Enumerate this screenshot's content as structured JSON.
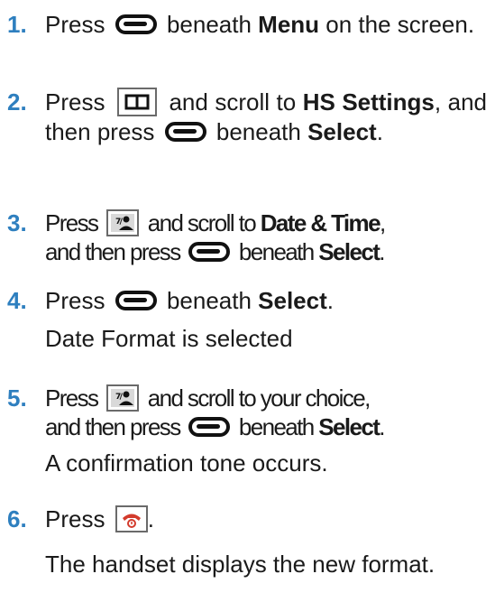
{
  "steps": [
    {
      "num": "1.",
      "t1": "Press",
      "t2": "beneath",
      "t3": "Menu",
      "t4": "on the screen."
    },
    {
      "num": "2.",
      "t1": "Press",
      "t2": "and scroll to",
      "t3": "HS Settings",
      "t4": ", and then press",
      "t5": "beneath",
      "t6": "Select",
      "t7": "."
    },
    {
      "num": "3.",
      "t1": "Press",
      "t2": "and scroll to",
      "t3": "Date & Time",
      "t4": ",",
      "t5": "and then press",
      "t6": "beneath",
      "t7": "Select",
      "t8": "."
    },
    {
      "num": "4.",
      "t1": "Press",
      "t2": "beneath",
      "t3": "Select",
      "t4": ".",
      "note": "Date Format is selected"
    },
    {
      "num": "5.",
      "t1": "Press",
      "t2": "and scroll to your choice,",
      "t3": "and then press",
      "t4": "beneath",
      "t5": "Select",
      "t6": ".",
      "note": "A confirmation tone occurs."
    },
    {
      "num": "6.",
      "t1": "Press",
      "t2": ".",
      "note": "The handset displays the new format."
    }
  ],
  "icons": {
    "soft_key": "soft-key-icon",
    "menu_key": "menu-book-key-icon",
    "nav_key": "navigation-key-icon",
    "end_key": "end-call-key-icon"
  },
  "colors": {
    "step_number": "#2e7fbf",
    "end_key_red": "#d33b2c"
  }
}
